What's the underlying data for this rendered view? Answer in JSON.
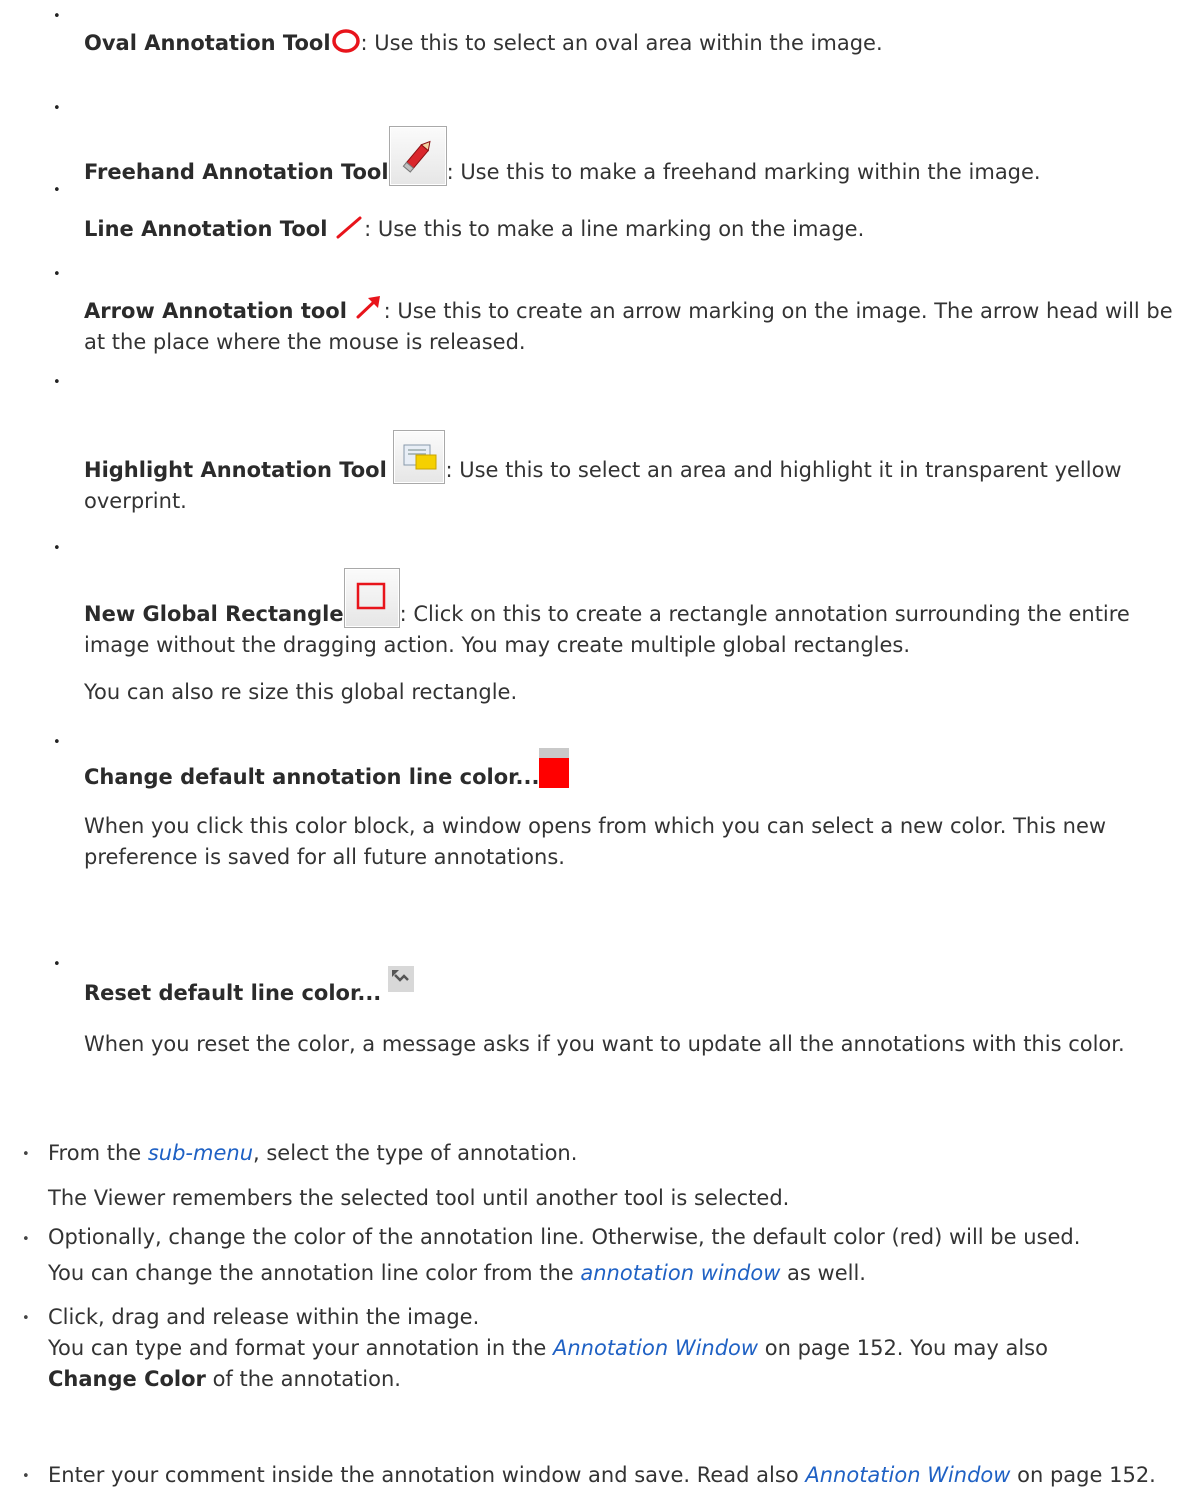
{
  "tools": [
    {
      "name": "Oval Annotation Tool",
      "icon": "oval-icon",
      "desc": ": Use this to select an oval area within the image."
    },
    {
      "name": "Freehand Annotation Tool",
      "icon": "pencil-icon",
      "desc": ": Use this to make a freehand marking within the image."
    },
    {
      "name": "Line Annotation Tool",
      "icon": "line-icon",
      "desc": ": Use this to make a line marking on the image."
    },
    {
      "name": "Arrow Annotation tool",
      "icon": "arrow-icon",
      "desc": ": Use this to create an arrow marking on the image. The arrow head will be at the place where the mouse is released."
    },
    {
      "name": "Highlight Annotation Tool",
      "icon": "highlight-icon",
      "desc": ": Use this to select an area and highlight it in transparent yellow overprint."
    },
    {
      "name": "New Global Rectangle",
      "icon": "global-rectangle-icon",
      "desc": ": Click on this to create a rectangle annotation surrounding the entire image without the dragging action. You may create multiple global rectangles.",
      "note": "You can also re size this global rectangle."
    },
    {
      "name": "Change default annotation line color...",
      "icon": "color-swatch-icon",
      "note": "When you click this color block, a window opens from which you can select a new color. This new preference is saved for all future annotations."
    },
    {
      "name": "Reset default line color...",
      "icon": "reset-icon",
      "note": "When you reset the color, a message asks if you want to update all the annotations with this color."
    }
  ],
  "steps": [
    {
      "pre": "From the ",
      "link": "sub-menu",
      "post": ", select the type of annotation.",
      "note": "The Viewer remembers the selected tool until another tool is selected."
    },
    {
      "text": "Optionally, change the color of the annotation line. Otherwise, the default color (red) will be used.",
      "note_pre": "You can change the annotation line color from the ",
      "note_link": "annotation window",
      "note_post": " as well."
    },
    {
      "text": "Click, drag and release within the image.",
      "line2_pre": "You can type and format your annotation in the ",
      "line2_link": "Annotation Window",
      "line2_post": " on page 152. You may also ",
      "line3_bold": "Change Color",
      "line3_post": " of the annotation."
    },
    {
      "pre": "Enter your comment inside the annotation window and save. Read also ",
      "link": "Annotation Window",
      "post": " on page 152."
    }
  ],
  "colors": {
    "accent_red": "#e8141b",
    "link_blue": "#1f61c4",
    "swatch_red": "#ff0000"
  }
}
